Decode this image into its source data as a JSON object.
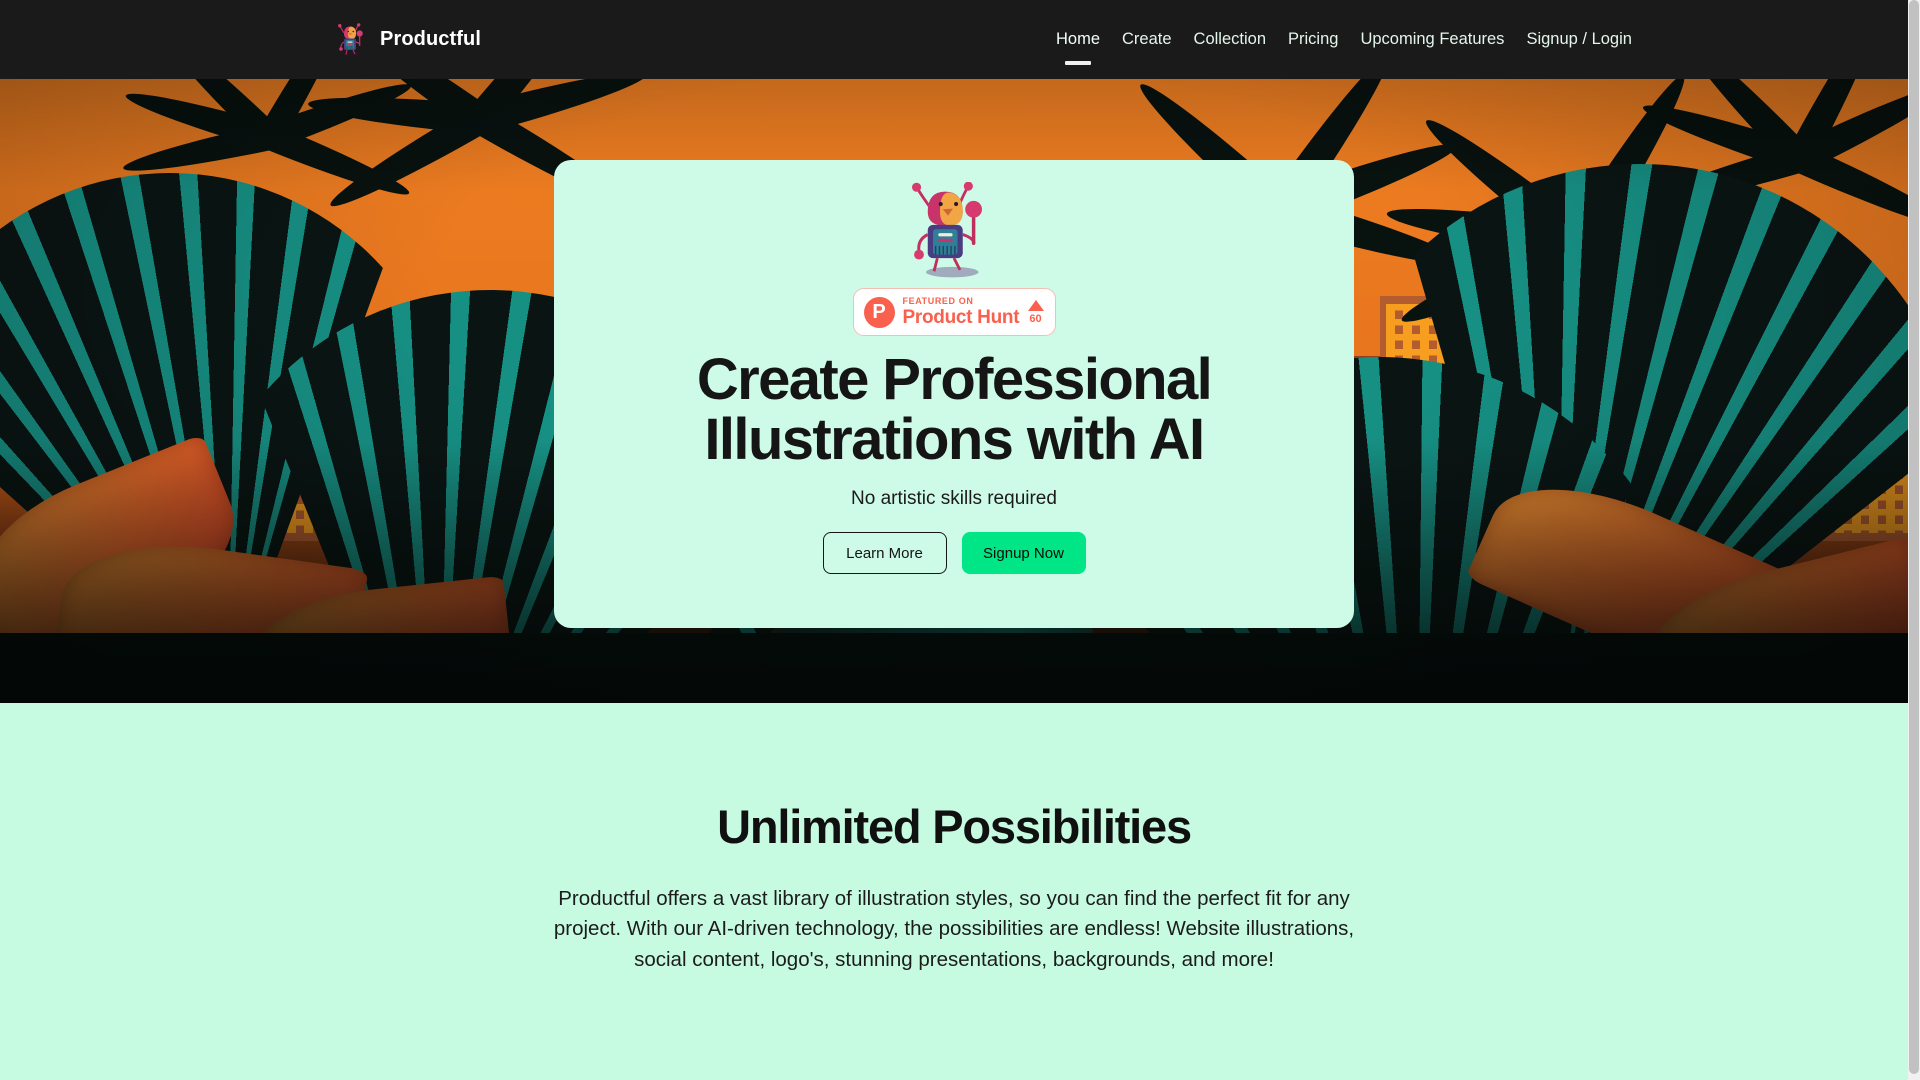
{
  "header": {
    "brand": {
      "name": "Productful",
      "logo_icon": "robot-mascot-icon"
    },
    "nav": [
      {
        "label": "Home",
        "active": true
      },
      {
        "label": "Create",
        "active": false
      },
      {
        "label": "Collection",
        "active": false
      },
      {
        "label": "Pricing",
        "active": false
      },
      {
        "label": "Upcoming Features",
        "active": false
      },
      {
        "label": "Signup / Login",
        "active": false
      }
    ]
  },
  "hero": {
    "background_description": "tropical sunset illustration with palm fronds and city skyline",
    "mascot_icon": "robot-mascot-icon",
    "badge": {
      "logo_letter": "P",
      "featured_label": "FEATURED ON",
      "product_name": "Product Hunt",
      "upvote_icon": "upvote-triangle-icon",
      "upvote_count": "60"
    },
    "title_line_1": "Create Professional",
    "title_line_2": "Illustrations with AI",
    "subtitle": "No artistic skills required",
    "buttons": {
      "secondary": "Learn More",
      "primary": "Signup Now"
    }
  },
  "section": {
    "title": "Unlimited Possibilities",
    "body": "Productful offers a vast library of illustration styles, so you can find the perfect fit for any project. With our AI-driven technology, the possibilities are endless! Website illustrations, social content, logo's, stunning presentations, backgrounds, and more!"
  },
  "colors": {
    "header_bg": "#1A1A1A",
    "card_bg": "#CDFBE7",
    "section_bg": "#C6FBE2",
    "primary_button": "#00E586",
    "product_hunt": "#F9604D",
    "sky_orange": "#EF7F22",
    "frond_teal": "#1C8D80"
  }
}
